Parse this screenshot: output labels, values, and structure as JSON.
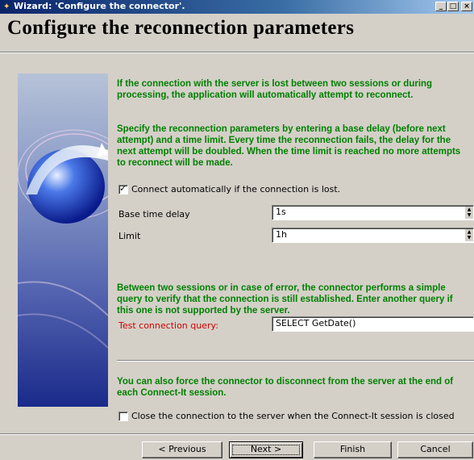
{
  "window": {
    "title": "Wizard: 'Configure the connector'.",
    "minimize_glyph": "_",
    "maximize_glyph": "□",
    "close_glyph": "×"
  },
  "page": {
    "heading": "Configure the reconnection parameters",
    "intro_1": "If the connection with the server is lost between two sessions or during processing, the application will automatically attempt to reconnect.",
    "intro_2": "Specify the reconnection parameters by entering a base delay (before next attempt) and a time limit. Every time the reconnection fails, the delay for the next attempt will be doubled. When the time limit is reached no more attempts to reconnect will be made."
  },
  "reconnect": {
    "auto_connect_label": "Connect automatically if the connection is lost.",
    "auto_connect_checked": true,
    "base_delay_label": "Base time delay",
    "base_delay_value": "1s",
    "limit_label": "Limit",
    "limit_value": "1h"
  },
  "test_query": {
    "description": "Between two sessions or in case of error, the connector performs a simple query to verify that the connection is still established. Enter another query if this one is not supported by the server.",
    "label": "Test connection query:",
    "value": "SELECT GetDate()"
  },
  "disconnect": {
    "description": "You can also force the connector to disconnect from the server at the end of each Connect-It session.",
    "close_label": "Close the connection to the server when the Connect-It session is closed",
    "close_checked": false
  },
  "buttons": {
    "previous": "< Previous",
    "next": "Next >",
    "finish": "Finish",
    "cancel": "Cancel"
  },
  "colors": {
    "description_text": "#008000",
    "required_label": "#cc0000",
    "title_bar": "#0a246a"
  },
  "icons": {
    "title": "wizard-icon",
    "graphic": "globe-icon"
  }
}
